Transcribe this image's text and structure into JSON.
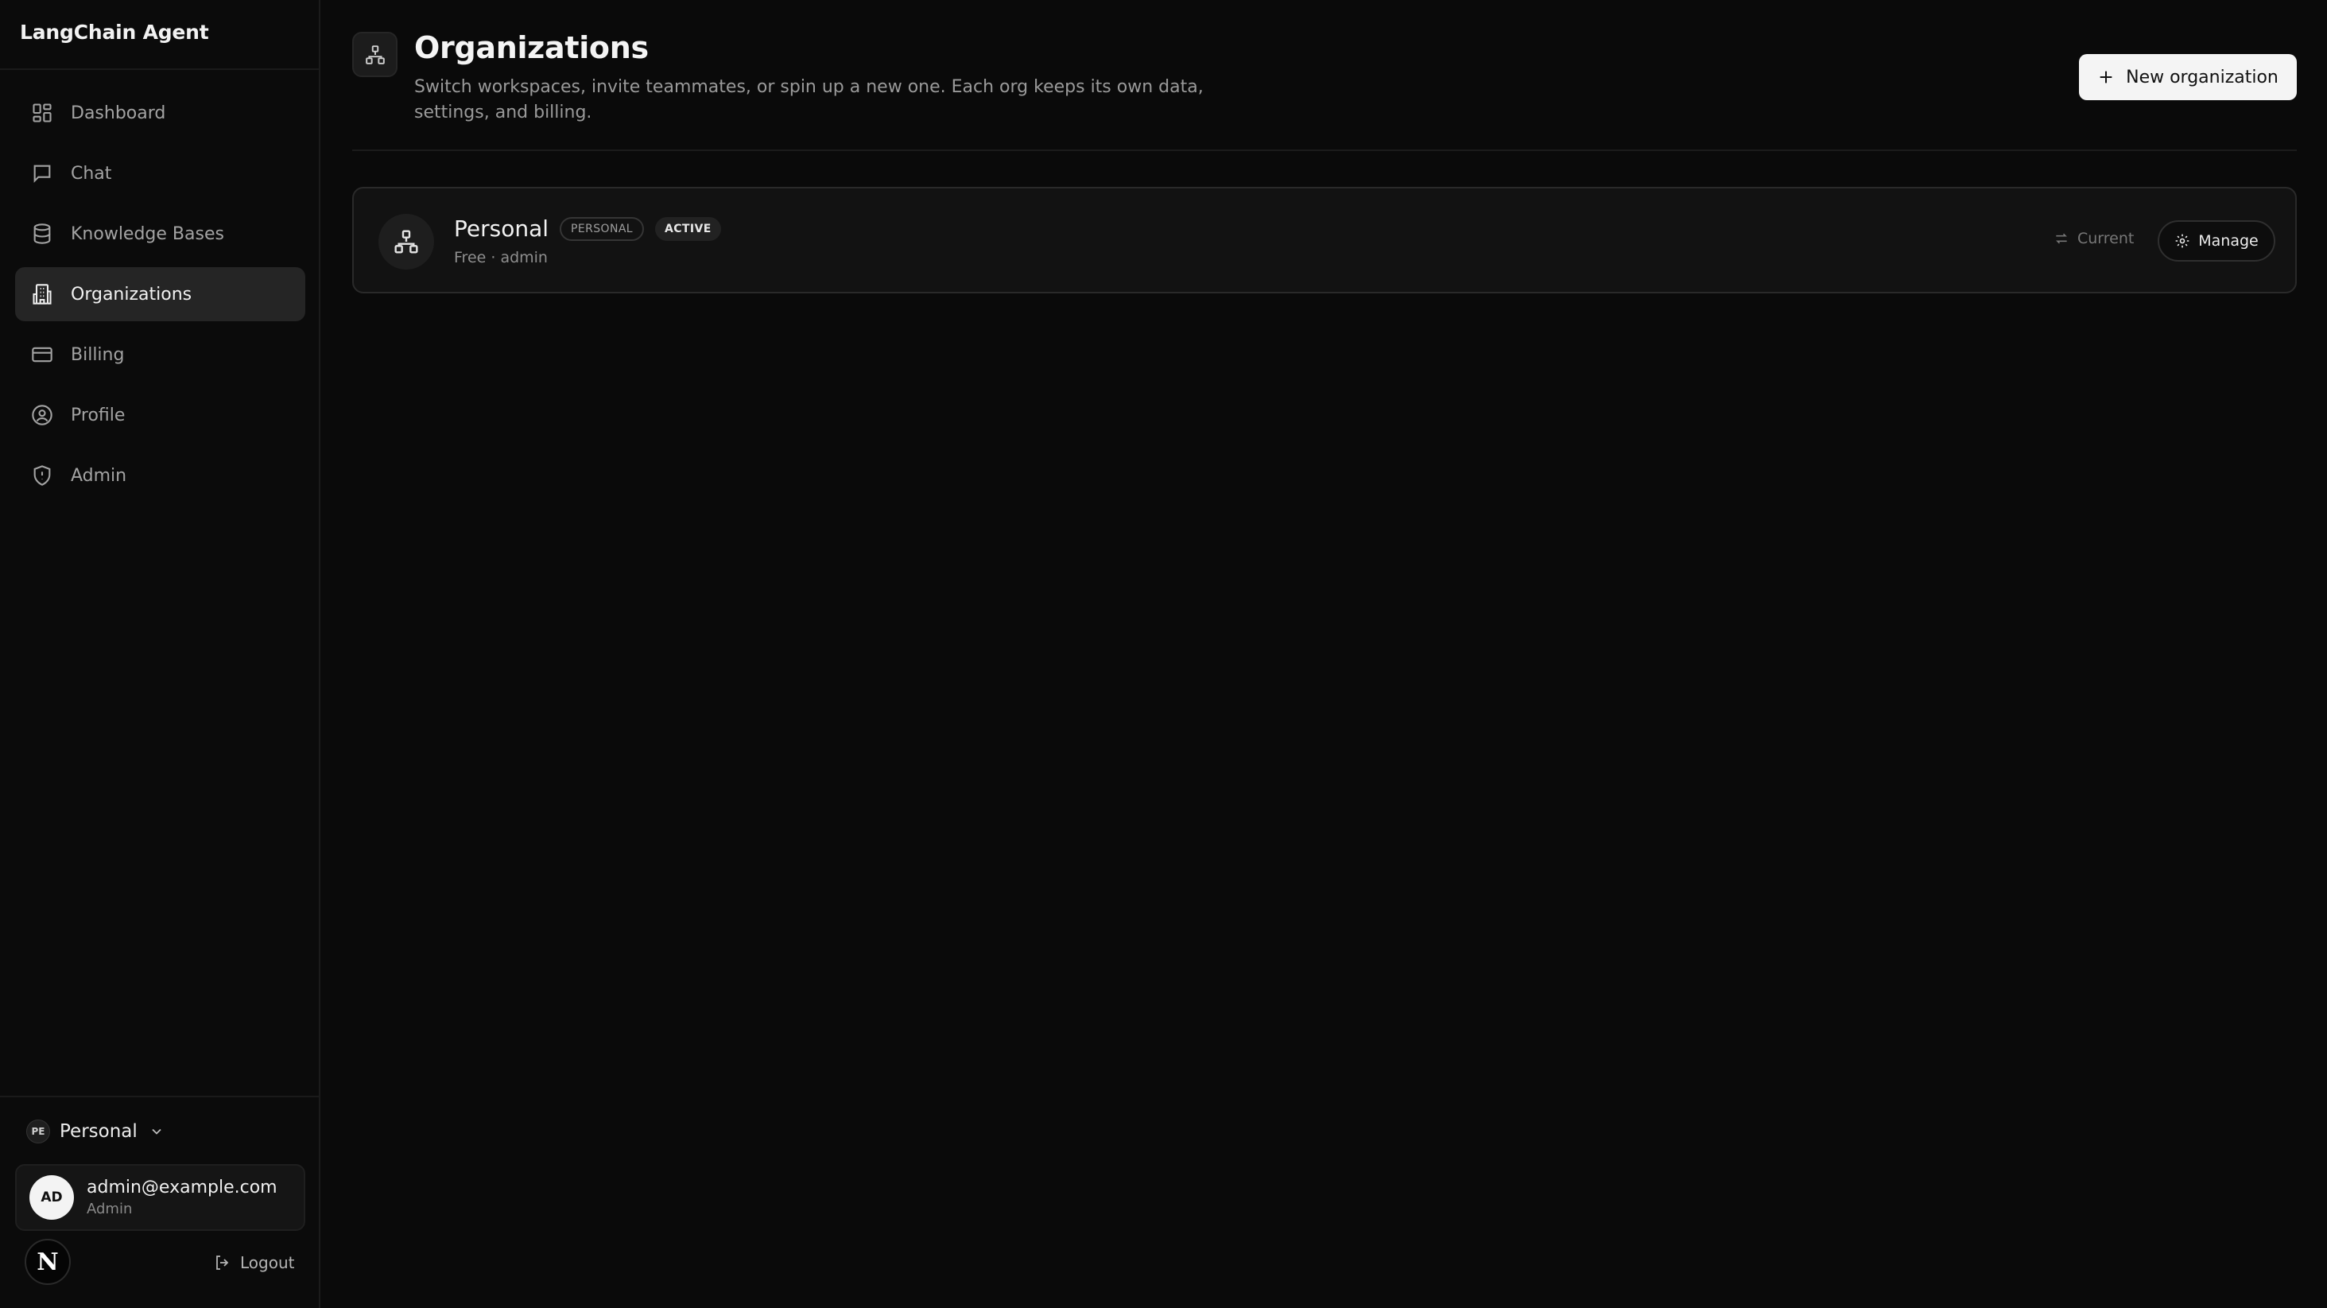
{
  "app": {
    "title": "LangChain Agent"
  },
  "sidebar": {
    "items": [
      {
        "label": "Dashboard",
        "icon": "dashboard-icon"
      },
      {
        "label": "Chat",
        "icon": "chat-icon"
      },
      {
        "label": "Knowledge Bases",
        "icon": "database-icon"
      },
      {
        "label": "Organizations",
        "icon": "building-icon",
        "active": true
      },
      {
        "label": "Billing",
        "icon": "credit-card-icon"
      },
      {
        "label": "Profile",
        "icon": "user-circle-icon"
      },
      {
        "label": "Admin",
        "icon": "shield-icon"
      }
    ],
    "org_switcher": {
      "initials": "PE",
      "name": "Personal"
    },
    "user": {
      "initials": "AD",
      "email": "admin@example.com",
      "role": "Admin"
    },
    "n_badge": "N",
    "logout_label": "Logout"
  },
  "main": {
    "title": "Organizations",
    "description": "Switch workspaces, invite teammates, or spin up a new one. Each org keeps its own data, settings, and billing.",
    "new_button_label": "New organization",
    "orgs": [
      {
        "name": "Personal",
        "type_badge": "PERSONAL",
        "status_badge": "ACTIVE",
        "meta": "Free · admin",
        "current_label": "Current",
        "manage_label": "Manage"
      }
    ]
  },
  "colors": {
    "background": "#0a0a0a",
    "active_nav": "#252525",
    "primary_button": "#f4f4f4"
  }
}
